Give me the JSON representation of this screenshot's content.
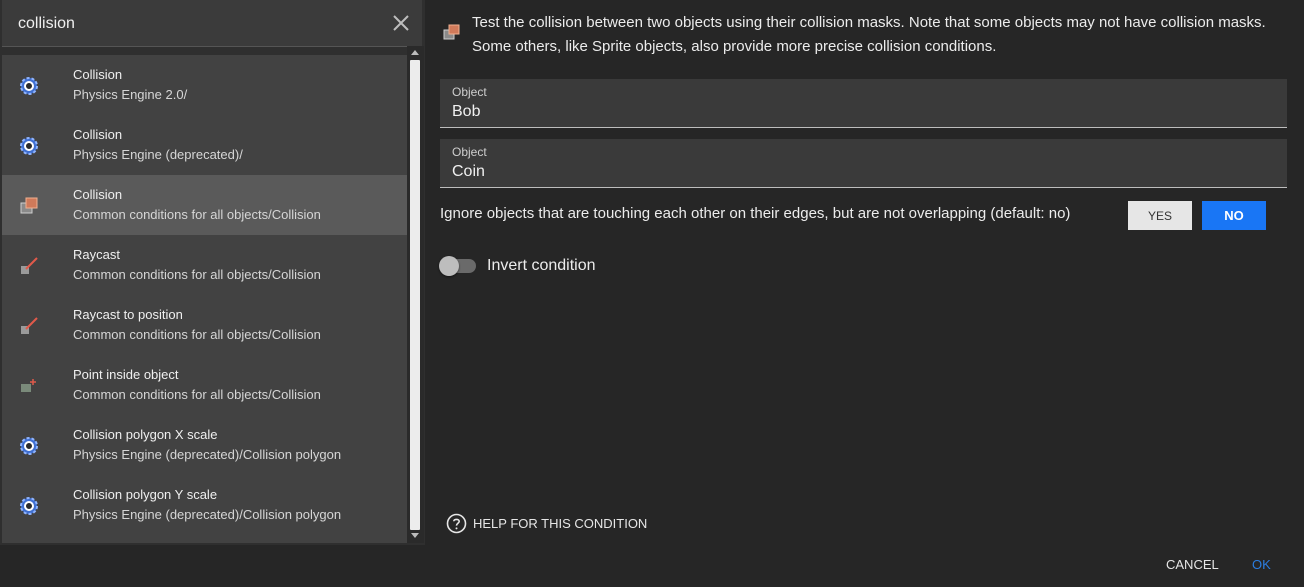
{
  "search": {
    "value": "collision"
  },
  "results": [
    {
      "title": "Collision",
      "path": "Physics Engine 2.0/",
      "icon": "physics-gear-icon"
    },
    {
      "title": "Collision",
      "path": "Physics Engine (deprecated)/",
      "icon": "physics-gear-icon"
    },
    {
      "title": "Collision",
      "path": "Common conditions for all objects/Collision",
      "icon": "collision-boxes-icon",
      "selected": true
    },
    {
      "title": "Raycast",
      "path": "Common conditions for all objects/Collision",
      "icon": "raycast-icon"
    },
    {
      "title": "Raycast to position",
      "path": "Common conditions for all objects/Collision",
      "icon": "raycast-icon"
    },
    {
      "title": "Point inside object",
      "path": "Common conditions for all objects/Collision",
      "icon": "point-inside-icon"
    },
    {
      "title": "Collision polygon X scale",
      "path": "Physics Engine (deprecated)/Collision polygon",
      "icon": "physics-gear-icon"
    },
    {
      "title": "Collision polygon Y scale",
      "path": "Physics Engine (deprecated)/Collision polygon",
      "icon": "physics-gear-icon"
    }
  ],
  "condition": {
    "description": "Test the collision between two objects using their collision masks. Note that some objects may not have collision masks. Some others, like Sprite objects, also provide more precise collision conditions.",
    "fields": [
      {
        "label": "Object",
        "value": "Bob"
      },
      {
        "label": "Object",
        "value": "Coin"
      }
    ],
    "ignore_edges_label": "Ignore objects that are touching each other on their edges, but are not overlapping (default: no)",
    "yes_label": "YES",
    "no_label": "NO",
    "selected_option": "NO",
    "invert_label": "Invert condition",
    "invert_enabled": false,
    "help_label": "HELP FOR THIS CONDITION"
  },
  "footer": {
    "cancel_label": "CANCEL",
    "ok_label": "OK"
  },
  "colors": {
    "accent": "#1976f5",
    "ok_text": "#2b7de0",
    "selected_row": "#5a5a5a"
  }
}
